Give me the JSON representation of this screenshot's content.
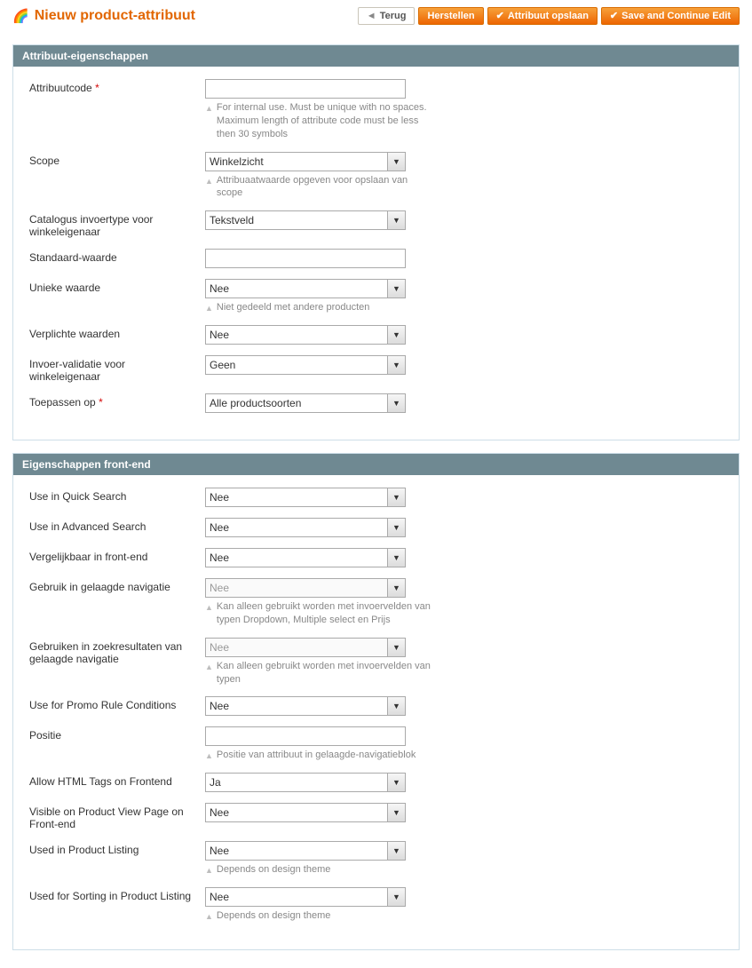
{
  "header": {
    "title": "Nieuw product-attribuut",
    "buttons": {
      "back": "Terug",
      "reset": "Herstellen",
      "save": "Attribuut opslaan",
      "save_continue": "Save and Continue Edit"
    }
  },
  "sections": {
    "props": {
      "title": "Attribuut-eigenschappen",
      "attr_code_label": "Attribuutcode",
      "attr_code_value": "",
      "attr_code_hint": "For internal use. Must be unique with no spaces. Maximum length of attribute code must be less then 30 symbols",
      "scope_label": "Scope",
      "scope_value": "Winkelzicht",
      "scope_hint": "Attribuaatwaarde opgeven voor opslaan van scope",
      "input_type_label": "Catalogus invoertype voor winkeleigenaar",
      "input_type_value": "Tekstveld",
      "default_label": "Standaard-waarde",
      "default_value": "",
      "unique_label": "Unieke waarde",
      "unique_value": "Nee",
      "unique_hint": "Niet gedeeld met andere producten",
      "required_label": "Verplichte waarden",
      "required_value": "Nee",
      "validation_label": "Invoer-validatie voor winkeleigenaar",
      "validation_value": "Geen",
      "apply_label": "Toepassen op",
      "apply_value": "Alle productsoorten"
    },
    "frontend": {
      "title": "Eigenschappen front-end",
      "quick_search_label": "Use in Quick Search",
      "quick_search_value": "Nee",
      "adv_search_label": "Use in Advanced Search",
      "adv_search_value": "Nee",
      "comparable_label": "Vergelijkbaar in front-end",
      "comparable_value": "Nee",
      "layered_label": "Gebruik in gelaagde navigatie",
      "layered_value": "Nee",
      "layered_hint": "Kan alleen gebruikt worden met invoervelden van typen Dropdown, Multiple select en Prijs",
      "layered_search_label": "Gebruiken in zoekresultaten van gelaagde navigatie",
      "layered_search_value": "Nee",
      "layered_search_hint": "Kan alleen gebruikt worden met invoervelden van typen",
      "promo_label": "Use for Promo Rule Conditions",
      "promo_value": "Nee",
      "position_label": "Positie",
      "position_value": "",
      "position_hint": "Positie van attribuut in gelaagde-navigatieblok",
      "html_label": "Allow HTML Tags on Frontend",
      "html_value": "Ja",
      "visible_label": "Visible on Product View Page on Front-end",
      "visible_value": "Nee",
      "listing_label": "Used in Product Listing",
      "listing_value": "Nee",
      "listing_hint": "Depends on design theme",
      "sorting_label": "Used for Sorting in Product Listing",
      "sorting_value": "Nee",
      "sorting_hint": "Depends on design theme"
    }
  }
}
